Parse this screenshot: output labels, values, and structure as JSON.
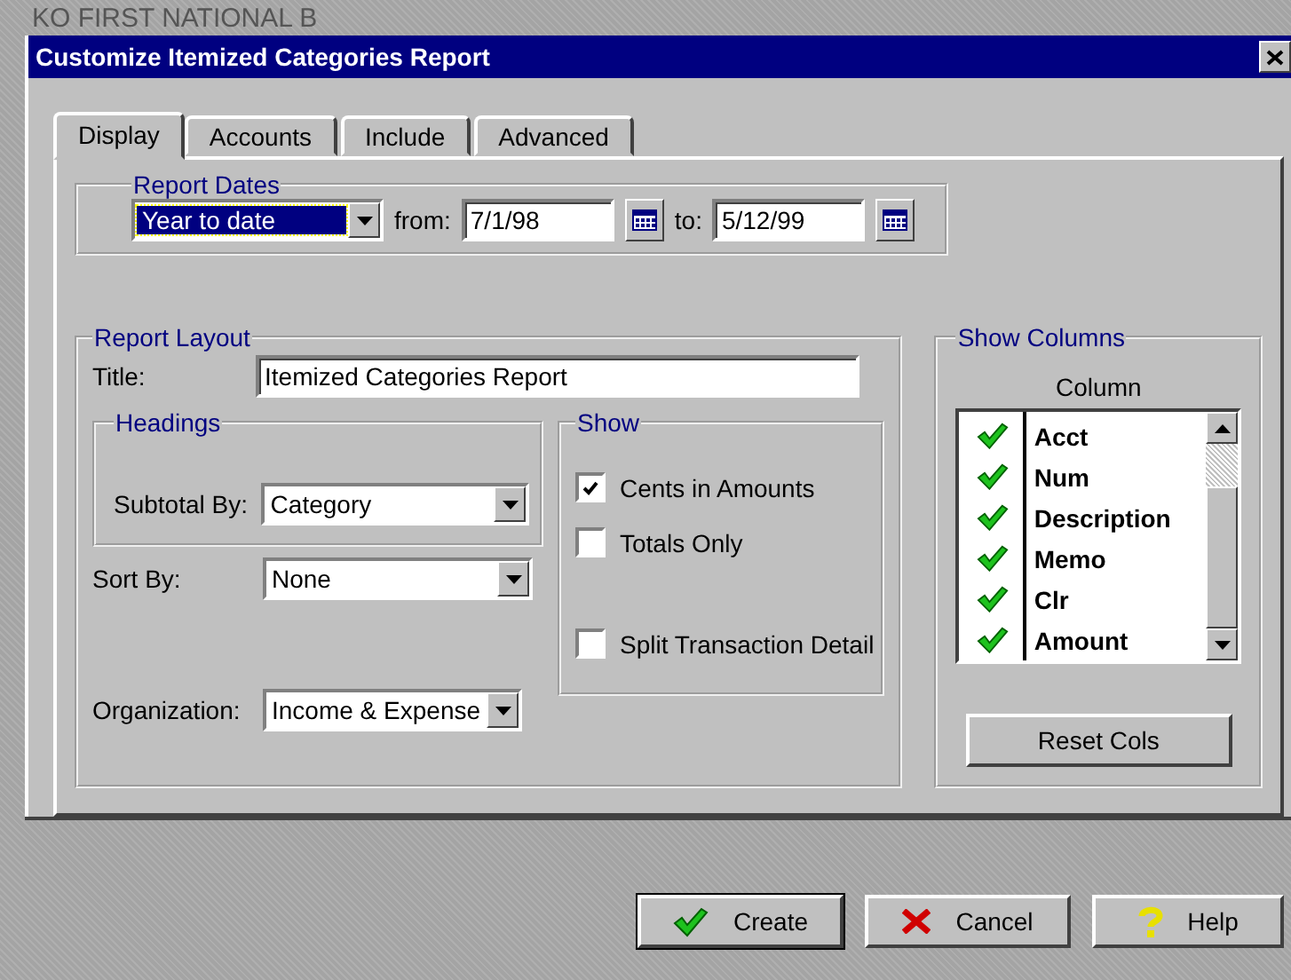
{
  "background_window": {
    "title": "KO FIRST NATIONAL B"
  },
  "window": {
    "title": "Customize Itemized Categories Report"
  },
  "tabs": [
    {
      "label": "Display",
      "selected": true
    },
    {
      "label": "Accounts",
      "selected": false
    },
    {
      "label": "Include",
      "selected": false
    },
    {
      "label": "Advanced",
      "selected": false
    }
  ],
  "report_dates": {
    "label": "Report Dates",
    "range": "Year to date",
    "from_label": "from:",
    "from": "7/1/98",
    "to_label": "to:",
    "to": "5/12/99"
  },
  "report_layout": {
    "label": "Report Layout",
    "title_label": "Title:",
    "title_value": "Itemized Categories Report",
    "headings": {
      "label": "Headings",
      "subtotal_label": "Subtotal By:",
      "subtotal": "Category"
    },
    "sort_label": "Sort By:",
    "sort": "None",
    "organization_label": "Organization:",
    "organization": "Income & Expense"
  },
  "show": {
    "label": "Show",
    "options": [
      {
        "label": "Cents in Amounts",
        "checked": true
      },
      {
        "label": "Totals Only",
        "checked": false
      },
      {
        "label": "Split Transaction Detail",
        "checked": false
      }
    ]
  },
  "show_columns": {
    "label": "Show Columns",
    "header": "Column",
    "columns": [
      {
        "name": "Acct",
        "checked": true
      },
      {
        "name": "Num",
        "checked": true
      },
      {
        "name": "Description",
        "checked": true
      },
      {
        "name": "Memo",
        "checked": true
      },
      {
        "name": "Clr",
        "checked": true
      },
      {
        "name": "Amount",
        "checked": true
      }
    ],
    "reset": "Reset Cols"
  },
  "buttons": [
    {
      "label": "Create",
      "kind": "create"
    },
    {
      "label": "Cancel",
      "kind": "cancel"
    },
    {
      "label": "Help",
      "kind": "help"
    }
  ]
}
